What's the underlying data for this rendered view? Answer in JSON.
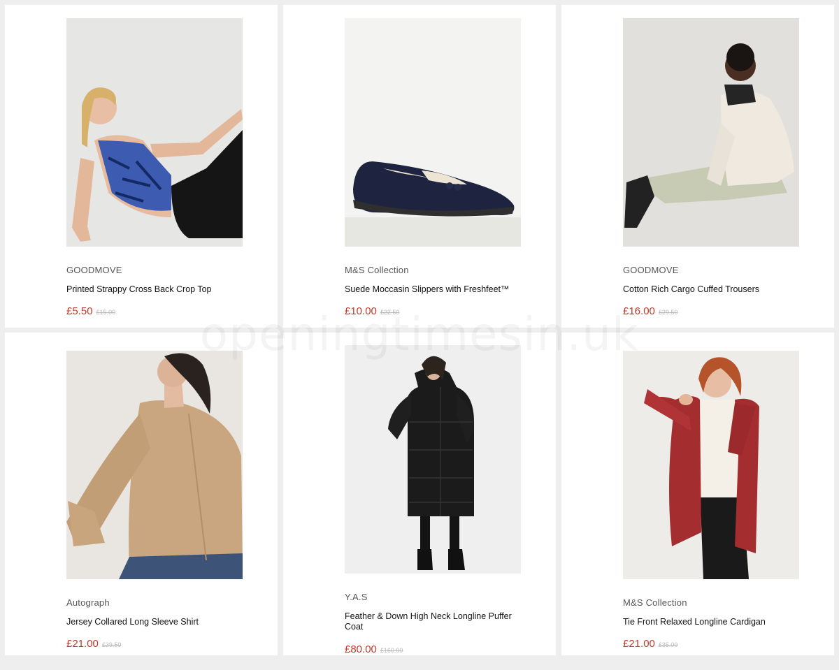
{
  "products": [
    {
      "brand": "GOODMOVE",
      "title": "Printed Strappy Cross Back Crop Top",
      "price": "£5.50",
      "was": "£15.00",
      "image": "woman-crop-top-photo"
    },
    {
      "brand": "M&S Collection",
      "title": "Suede Moccasin Slippers with Freshfeet™",
      "price": "£10.00",
      "was": "£22.50",
      "image": "navy-moccasin-slipper-photo"
    },
    {
      "brand": "GOODMOVE",
      "title": "Cotton Rich Cargo Cuffed Trousers",
      "price": "£16.00",
      "was": "£29.50",
      "image": "woman-cargo-trousers-photo"
    },
    {
      "brand": "Autograph",
      "title": "Jersey Collared Long Sleeve Shirt",
      "price": "£21.00",
      "was": "£39.50",
      "image": "woman-camel-shirt-photo"
    },
    {
      "brand": "Y.A.S",
      "title": "Feather & Down High Neck Longline Puffer Coat",
      "price": "£80.00",
      "was": "£160.00",
      "image": "woman-black-puffer-coat-photo"
    },
    {
      "brand": "M&S Collection",
      "title": "Tie Front Relaxed Longline Cardigan",
      "price": "£21.00",
      "was": "£35.00",
      "image": "woman-red-cardigan-photo"
    }
  ],
  "watermark": "openingtimesin.uk",
  "colors": {
    "price": "#c0392b",
    "was_price": "#b9b9b9",
    "background": "#eeeeee",
    "card": "#ffffff"
  }
}
